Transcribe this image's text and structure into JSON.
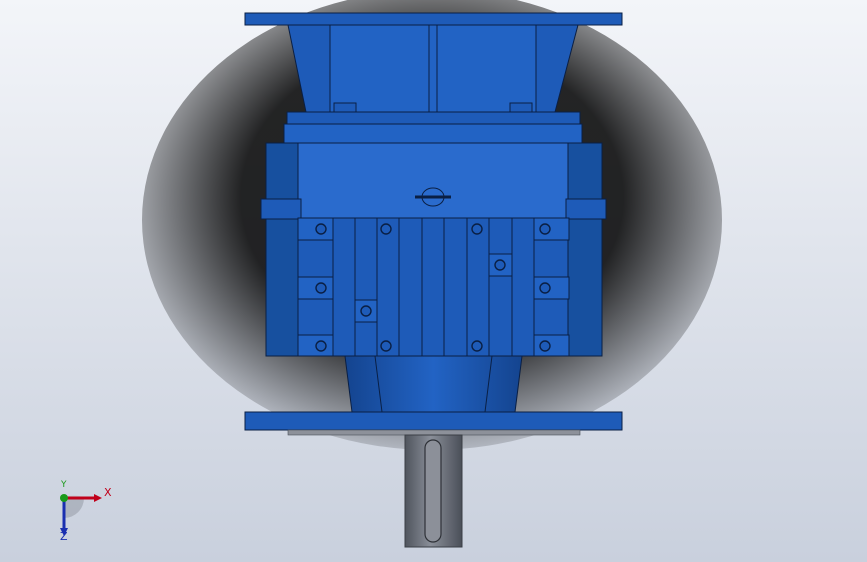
{
  "viewport": {
    "background_top": "#f2f4f8",
    "background_bottom": "#c8cfdc"
  },
  "model": {
    "body_color": "#1e5bb8",
    "body_light": "#2d6fd0",
    "body_dark": "#123f86",
    "edge_color": "#0a1f44",
    "shaft_color": "#6f7480"
  },
  "triad": {
    "x_label": "X",
    "y_label": "Y",
    "z_label": "Z",
    "x_color": "#c0001a",
    "y_color": "#1a9a1a",
    "z_color": "#1a2fb0"
  }
}
